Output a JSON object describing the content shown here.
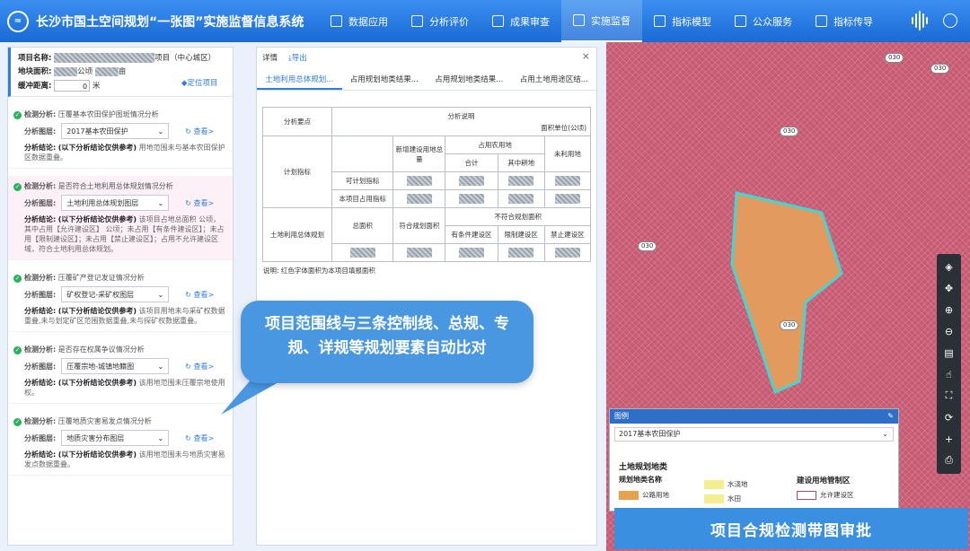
{
  "header": {
    "logo_text": "≈",
    "title": "长沙市国土空间规划“一张图”实施监督信息系统",
    "nav": [
      {
        "label": "数据应用",
        "icon": "database-icon"
      },
      {
        "label": "分析评价",
        "icon": "analysis-icon"
      },
      {
        "label": "成果审查",
        "icon": "review-icon"
      },
      {
        "label": "实施监督",
        "icon": "monitor-icon"
      },
      {
        "label": "指标模型",
        "icon": "model-icon"
      },
      {
        "label": "公众服务",
        "icon": "public-icon"
      },
      {
        "label": "指标传导",
        "icon": "transfer-icon"
      }
    ],
    "active_nav": 3
  },
  "project": {
    "name_label": "项目名称:",
    "name_suffix": "项目（中心城区）",
    "area_label": "地块面积:",
    "area_unit1": "公顷",
    "area_unit2": "亩",
    "locate": "定位项目",
    "buffer_label": "缓冲距离:",
    "buffer_value": "0",
    "buffer_unit": "米"
  },
  "sections": [
    {
      "analysis": "压覆基本农田保护图斑情况分析",
      "layer": "2017基本农田保护",
      "conclusion": "用地范围未与基本农田保护区数据重叠。",
      "pink": false
    },
    {
      "analysis": "是否符合土地利用总体规划情况分析",
      "layer": "土地利用总体规划图层",
      "conclusion": "该项目占地总面积 公顷，其中占用【允许建设区】 公顷；未占用【有条件建设区】；未占用【限制建设区】；未占用【禁止建设区】；占用不允许建设区域，符合土地利用总体规划。",
      "pink": true
    },
    {
      "analysis": "压覆矿产登记发证情况分析",
      "layer": "矿权登记-采矿权图层",
      "conclusion": "该项目用地未与采矿权数据重叠,未与划定矿区范围数据重叠,未与探矿权数据重叠。",
      "pink": false
    },
    {
      "analysis": "是否存在权属争议情况分析",
      "layer": "压覆宗地-城镇地籍图",
      "conclusion": "该用地范围未压覆宗地使用权。",
      "pink": false
    },
    {
      "analysis": "压覆地质灾害易发点情况分析",
      "layer": "地质灾害分布图层",
      "conclusion": "该用地范围未与地质灾害易发点数据重叠。",
      "pink": false
    }
  ],
  "labels": {
    "analysis": "检测分析:",
    "layer": "分析图层:",
    "conclusion": "分析结论:",
    "conclusion_note": "(以下分析结论仅供参考)",
    "view": "查看>"
  },
  "detail": {
    "title": "详情",
    "export": "导出",
    "tabs": [
      "土地利用总体规划...",
      "占用规划地类结果...",
      "占用规划地类结果...",
      "占用土地用途区结..."
    ],
    "table": {
      "h_key": "分析要点",
      "h_desc": "分析说明",
      "h_unit": "面积单位(公顷)",
      "plan_index": "计划指标",
      "new_total": "新增建设用地总量",
      "occupy_farm": "占用农用地",
      "total": "合计",
      "of_cultivated": "其中耕地",
      "unused": "未利用地",
      "plannable": "可计划指标",
      "this_project": "本项目占用指标",
      "land_plan": "土地利用总体规划",
      "total_area": "总面积",
      "compliant": "符合规划面积",
      "noncompliant": "不符合规划面积",
      "conditional": "有条件建设区",
      "restricted": "限制建设区",
      "prohibited": "禁止建设区"
    },
    "note": "说明: 红色字体面积为本项目填报面积"
  },
  "bubble": "项目范围线与三条控制线、总规、专规、详规等规划要素自动比对",
  "map": {
    "labels": [
      "030",
      "030",
      "030",
      "030",
      "030"
    ]
  },
  "legend": {
    "title": "图例",
    "select": "2017基本农田保护",
    "section": "土地规划地类",
    "col1_title": "规划地类名称",
    "col3_title": "建设用地管制区",
    "items": [
      "公路用地",
      "水浇地",
      "水田",
      "允许建设区"
    ]
  },
  "banner": "项目合规检测带图审批"
}
